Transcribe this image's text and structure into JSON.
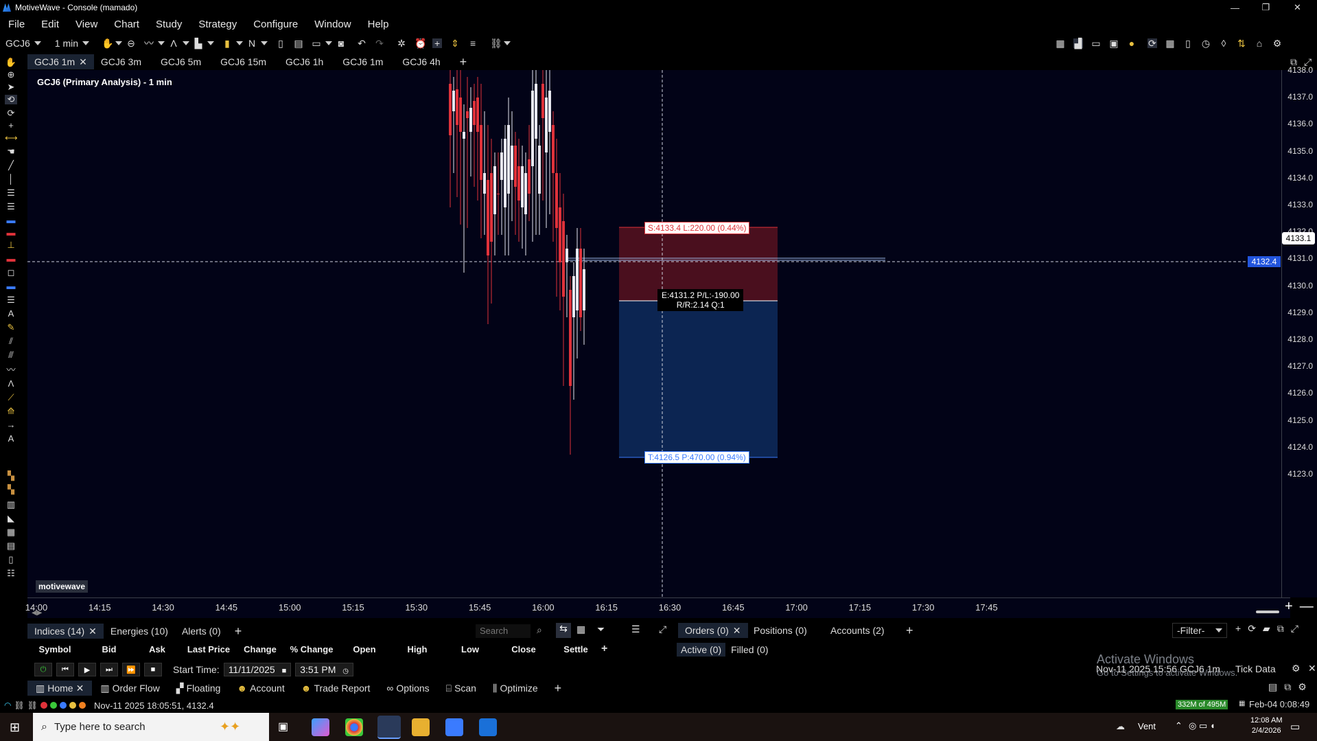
{
  "window": {
    "title": "MotiveWave - Console (mamado)",
    "controls": [
      "—",
      "❐",
      "✕"
    ]
  },
  "menu": [
    "File",
    "Edit",
    "View",
    "Chart",
    "Study",
    "Strategy",
    "Configure",
    "Window",
    "Help"
  ],
  "toolbar": {
    "symbol": "GCJ6",
    "interval": "1 min",
    "bar_type": "N"
  },
  "chart_tabs": [
    {
      "label": "GCJ6 1m",
      "active": true,
      "closable": true
    },
    {
      "label": "GCJ6 3m"
    },
    {
      "label": "GCJ6 5m"
    },
    {
      "label": "GCJ6 15m"
    },
    {
      "label": "GCJ6 1h"
    },
    {
      "label": "GCJ6 1m"
    },
    {
      "label": "GCJ6 4h"
    }
  ],
  "chart_title": "GCJ6 (Primary Analysis) - 1 min",
  "watermark": "motivewave",
  "y_ticks": [
    "4138.0",
    "4137.0",
    "4136.0",
    "4135.0",
    "4134.0",
    "4133.0",
    "4132.0",
    "4131.0",
    "4130.0",
    "4129.0",
    "4128.0",
    "4127.0",
    "4126.0",
    "4125.0",
    "4124.0",
    "4123.0"
  ],
  "x_ticks": [
    "14:00",
    "14:15",
    "14:30",
    "14:45",
    "15:00",
    "15:15",
    "15:30",
    "15:45",
    "16:00",
    "16:15",
    "16:30",
    "16:45",
    "17:00",
    "17:15",
    "17:30",
    "17:45"
  ],
  "price_current": "4133.1",
  "price_cursor": "4132.4",
  "position_tool": {
    "stop_label": "S:4133.4 L:220.00 (0.44%)",
    "entry_label_1": "E:4131.2 P/L:-190.00",
    "entry_label_2": "R/R:2.14 Q:1",
    "target_label": "T:4126.5 P:470.00 (0.94%)"
  },
  "bottom_tabs": [
    {
      "label": "Indices (14)",
      "active": true,
      "closable": true
    },
    {
      "label": "Energies (10)"
    },
    {
      "label": "Alerts (0)"
    }
  ],
  "search_placeholder": "Search",
  "orders_tabs": [
    {
      "label": "Orders (0)",
      "active": true,
      "closable": true
    },
    {
      "label": "Positions (0)"
    },
    {
      "label": "Accounts (2)"
    }
  ],
  "orders_subtabs": [
    "Active (0)",
    "Filled (0)"
  ],
  "filter_label": "-Filter-",
  "watchlist_columns": [
    "Symbol",
    "Bid",
    "Ask",
    "Last Price",
    "Change",
    "% Change",
    "Open",
    "High",
    "Low",
    "Close",
    "Settle"
  ],
  "replay": {
    "start_time_label": "Start Time:",
    "date": "11/11/2025",
    "time": "3:51 PM",
    "right_info": "Nov-11 2025 15:56 GCJ6 1m",
    "tick_data": "Tick Data"
  },
  "activation": {
    "title": "Activate Windows",
    "subtitle": "Go to Settings to activate Windows."
  },
  "bottom_nav": [
    {
      "label": "Home",
      "active": true,
      "closable": true
    },
    {
      "label": "Order Flow"
    },
    {
      "label": "Floating"
    },
    {
      "label": "Account"
    },
    {
      "label": "Trade Report"
    },
    {
      "label": "Options"
    },
    {
      "label": "Scan"
    },
    {
      "label": "Optimize"
    }
  ],
  "status": {
    "text": "Nov-11 2025 18:05:51, 4132.4",
    "memory": "332M of 495M",
    "clock": "Feb-04 0:08:49"
  },
  "taskbar": {
    "search_placeholder": "Type here to search",
    "weather": "Vent",
    "time": "12:08 AM",
    "date": "2/4/2026"
  },
  "colors": {
    "chart_bg": "#020317",
    "bull": "#e8e8f0",
    "bear": "#e0323a",
    "stop_zone": "#4a0f1e",
    "target_zone": "#0c2552"
  }
}
